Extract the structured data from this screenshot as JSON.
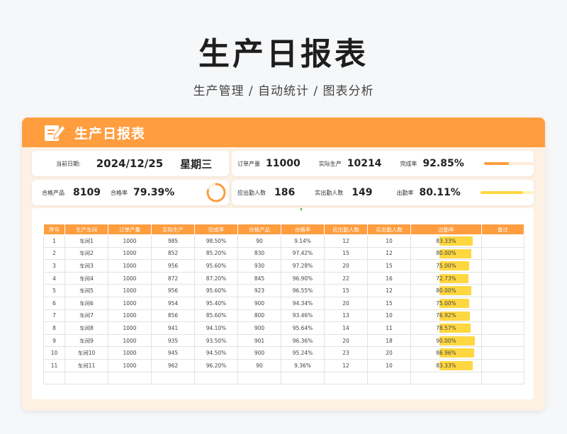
{
  "page": {
    "title": "生产日报表",
    "subtitle": "生产管理 / 自动统计 / 图表分析"
  },
  "report": {
    "header_title": "生产日报表",
    "date_label": "当前日期:",
    "date_value": "2024/12/25",
    "weekday": "星期三",
    "order_label": "订单产量",
    "order_value": "11000",
    "actual_label": "实际生产",
    "actual_value": "10214",
    "completion_label": "完成率",
    "completion_value": "92.85%",
    "completion_fraction": 0.5,
    "qualified_label": "合格产品",
    "qualified_value": "8109",
    "pass_rate_label": "合格率",
    "pass_rate_value": "79.39%",
    "pass_rate_fraction": 0.7939,
    "expected_label": "应出勤人数",
    "expected_value": "186",
    "present_label": "实出勤人数",
    "present_value": "149",
    "attendance_label": "出勤率",
    "attendance_value": "80.11%",
    "attendance_fraction": 0.8011,
    "colors": {
      "accent": "#ff9d3f",
      "attendance_bar": "#ffd740",
      "panel_bg": "#fdf1e4"
    }
  },
  "table": {
    "columns": [
      "序号",
      "生产车间",
      "订单产量",
      "实际生产",
      "完成率",
      "合格产品",
      "合格率",
      "应出勤人数",
      "实出勤人数",
      "出勤率",
      "备注"
    ],
    "rows": [
      [
        "1",
        "车间1",
        "1000",
        "985",
        "98.50%",
        "90",
        "9.14%",
        "12",
        "10",
        "83.33%",
        ""
      ],
      [
        "2",
        "车间2",
        "1000",
        "852",
        "85.20%",
        "830",
        "97.42%",
        "15",
        "12",
        "80.00%",
        ""
      ],
      [
        "3",
        "车间3",
        "1000",
        "956",
        "95.60%",
        "930",
        "97.28%",
        "20",
        "15",
        "75.00%",
        ""
      ],
      [
        "4",
        "车间4",
        "1000",
        "872",
        "87.20%",
        "845",
        "96.90%",
        "22",
        "16",
        "72.73%",
        ""
      ],
      [
        "5",
        "车间5",
        "1000",
        "956",
        "95.60%",
        "923",
        "96.55%",
        "15",
        "12",
        "80.00%",
        ""
      ],
      [
        "6",
        "车间6",
        "1000",
        "954",
        "95.40%",
        "900",
        "94.34%",
        "20",
        "15",
        "75.00%",
        ""
      ],
      [
        "7",
        "车间7",
        "1000",
        "856",
        "85.60%",
        "800",
        "93.46%",
        "13",
        "10",
        "76.92%",
        ""
      ],
      [
        "8",
        "车间8",
        "1000",
        "941",
        "94.10%",
        "900",
        "95.64%",
        "14",
        "11",
        "78.57%",
        ""
      ],
      [
        "9",
        "车间9",
        "1000",
        "935",
        "93.50%",
        "901",
        "96.36%",
        "20",
        "18",
        "90.00%",
        ""
      ],
      [
        "10",
        "车间10",
        "1000",
        "945",
        "94.50%",
        "900",
        "95.24%",
        "23",
        "20",
        "86.96%",
        ""
      ],
      [
        "11",
        "车间11",
        "1000",
        "962",
        "96.20%",
        "90",
        "9.36%",
        "12",
        "10",
        "83.33%",
        ""
      ],
      [
        "",
        "",
        "",
        "",
        "",
        "",
        "",
        "",
        "",
        "",
        ""
      ]
    ],
    "attendance_fractions": [
      0.8333,
      0.8,
      0.75,
      0.7273,
      0.8,
      0.75,
      0.7692,
      0.7857,
      0.9,
      0.8696,
      0.8333
    ]
  }
}
